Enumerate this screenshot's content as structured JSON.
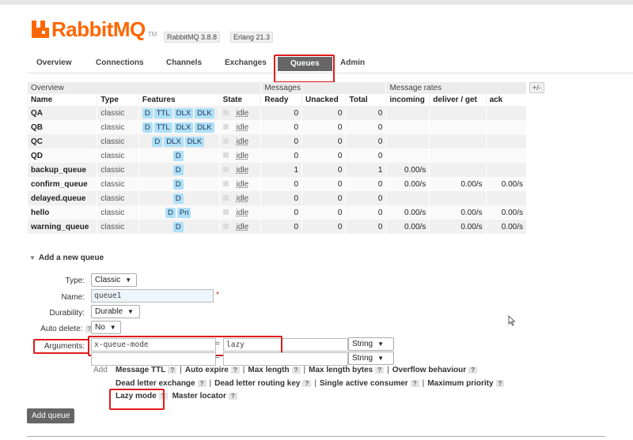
{
  "brand": {
    "name": "RabbitMQ",
    "tm": "TM",
    "version": "RabbitMQ 3.8.8",
    "erlang": "Erlang 21.3",
    "accent": "#ff6600"
  },
  "tabs": [
    "Overview",
    "Connections",
    "Channels",
    "Exchanges",
    "Queues",
    "Admin"
  ],
  "active_tab": "Queues",
  "table": {
    "group_headers": {
      "overview": "Overview",
      "messages": "Messages",
      "rates": "Message rates",
      "toggle": "+/-"
    },
    "columns": [
      "Name",
      "Type",
      "Features",
      "State",
      "Ready",
      "Unacked",
      "Total",
      "incoming",
      "deliver / get",
      "ack"
    ],
    "rows": [
      {
        "name": "QA",
        "type": "classic",
        "features": [
          "D",
          "TTL",
          "DLX",
          "DLK"
        ],
        "state": "idle",
        "ready": "0",
        "unacked": "0",
        "total": "0",
        "incoming": "",
        "deliver": "",
        "ack": ""
      },
      {
        "name": "QB",
        "type": "classic",
        "features": [
          "D",
          "TTL",
          "DLX",
          "DLK"
        ],
        "state": "idle",
        "ready": "0",
        "unacked": "0",
        "total": "0",
        "incoming": "",
        "deliver": "",
        "ack": ""
      },
      {
        "name": "QC",
        "type": "classic",
        "features": [
          "D",
          "DLX",
          "DLK"
        ],
        "state": "idle",
        "ready": "0",
        "unacked": "0",
        "total": "0",
        "incoming": "",
        "deliver": "",
        "ack": ""
      },
      {
        "name": "QD",
        "type": "classic",
        "features": [
          "D"
        ],
        "state": "idle",
        "ready": "0",
        "unacked": "0",
        "total": "0",
        "incoming": "",
        "deliver": "",
        "ack": ""
      },
      {
        "name": "backup_queue",
        "type": "classic",
        "features": [
          "D"
        ],
        "state": "idle",
        "ready": "1",
        "unacked": "0",
        "total": "1",
        "incoming": "0.00/s",
        "deliver": "",
        "ack": ""
      },
      {
        "name": "confirm_queue",
        "type": "classic",
        "features": [
          "D"
        ],
        "state": "idle",
        "ready": "0",
        "unacked": "0",
        "total": "0",
        "incoming": "0.00/s",
        "deliver": "0.00/s",
        "ack": "0.00/s"
      },
      {
        "name": "delayed.queue",
        "type": "classic",
        "features": [
          "D"
        ],
        "state": "idle",
        "ready": "0",
        "unacked": "0",
        "total": "0",
        "incoming": "",
        "deliver": "",
        "ack": ""
      },
      {
        "name": "hello",
        "type": "classic",
        "features": [
          "D",
          "Pri"
        ],
        "state": "idle",
        "ready": "0",
        "unacked": "0",
        "total": "0",
        "incoming": "0.00/s",
        "deliver": "0.00/s",
        "ack": "0.00/s"
      },
      {
        "name": "warning_queue",
        "type": "classic",
        "features": [
          "D"
        ],
        "state": "idle",
        "ready": "0",
        "unacked": "0",
        "total": "0",
        "incoming": "0.00/s",
        "deliver": "0.00/s",
        "ack": "0.00/s"
      }
    ]
  },
  "form": {
    "title": "Add a new queue",
    "type_label": "Type:",
    "type_value": "Classic",
    "name_label": "Name:",
    "name_value": "queue1",
    "required_mark": "*",
    "durability_label": "Durability:",
    "durability_value": "Durable",
    "autodelete_label": "Auto delete:",
    "autodelete_value": "No",
    "arguments_label": "Arguments:",
    "arg_key": "x-queue-mode",
    "arg_eq": "=",
    "arg_value": "lazy",
    "arg_type": "String",
    "arg2_type": "String",
    "add_label": "Add",
    "help": "?",
    "hints_row1": [
      "Message TTL",
      "Auto expire",
      "Max length",
      "Max length bytes",
      "Overflow behaviour"
    ],
    "hints_row2": [
      "Dead letter exchange",
      "Dead letter routing key",
      "Single active consumer",
      "Maximum priority"
    ],
    "hints_row3": [
      "Lazy mode",
      "Master locator"
    ],
    "separator": "|",
    "submit": "Add queue"
  }
}
